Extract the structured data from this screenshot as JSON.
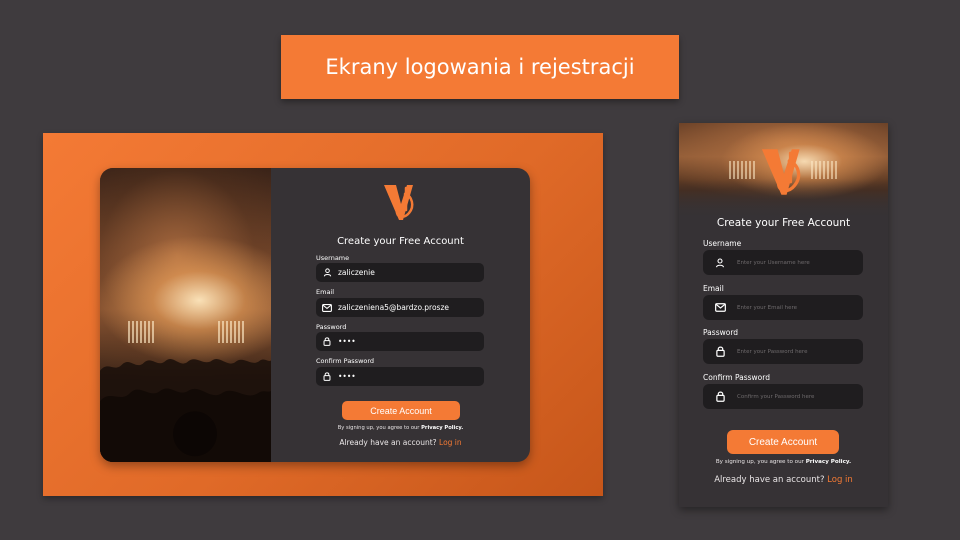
{
  "slide": {
    "title": "Ekrany logowania i rejestracji"
  },
  "colors": {
    "accent": "#f47a35",
    "background": "#3f3b3e",
    "card": "#363235",
    "field": "#1f1d1f"
  },
  "desktop": {
    "form_title": "Create your Free Account",
    "fields": {
      "username": {
        "label": "Username",
        "value": "zaliczenie",
        "icon": "user-icon"
      },
      "email": {
        "label": "Email",
        "value": "zaliczeniena5@bardzo.prosze",
        "icon": "mail-icon"
      },
      "password": {
        "label": "Password",
        "value": "••••",
        "icon": "lock-icon"
      },
      "confirm_password": {
        "label": "Confirm Password",
        "value": "••••",
        "icon": "lock-icon"
      }
    },
    "submit_label": "Create Account",
    "terms_prefix": "By signing up, you agree to our",
    "terms_link": "Privacy Policy.",
    "login_prompt": "Already have an account?",
    "login_link": "Log in"
  },
  "mobile": {
    "form_title": "Create your Free Account",
    "fields": {
      "username": {
        "label": "Username",
        "placeholder": "Enter your Username here",
        "icon": "user-icon"
      },
      "email": {
        "label": "Email",
        "placeholder": "Enter your Email here",
        "icon": "mail-icon"
      },
      "password": {
        "label": "Password",
        "placeholder": "Enter your Password here",
        "icon": "lock-icon"
      },
      "confirm_password": {
        "label": "Confirm Password",
        "placeholder": "Confirm your Password here",
        "icon": "lock-icon"
      }
    },
    "submit_label": "Create Account",
    "terms_prefix": "By signing up, you agree to our",
    "terms_link": "Privacy Policy.",
    "login_prompt": "Already have an account?",
    "login_link": "Log in"
  }
}
